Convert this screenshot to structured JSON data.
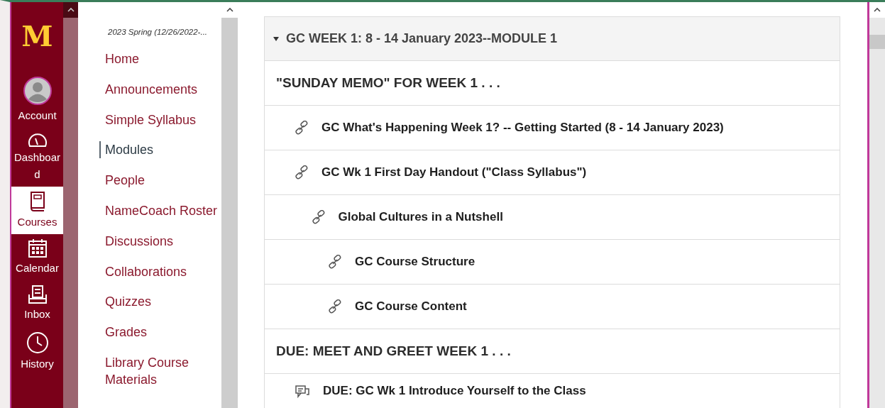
{
  "logo": "M",
  "global_nav": [
    {
      "label": "Account",
      "kind": "account",
      "selected": false
    },
    {
      "label": "Dashboard",
      "kind": "dashboard",
      "selected": false
    },
    {
      "label": "Courses",
      "kind": "courses",
      "selected": true
    },
    {
      "label": "Calendar",
      "kind": "calendar",
      "selected": false
    },
    {
      "label": "Inbox",
      "kind": "inbox",
      "selected": false
    },
    {
      "label": "History",
      "kind": "history",
      "selected": false
    }
  ],
  "course_nav": {
    "term": "2023 Spring (12/26/2022-...",
    "items": [
      {
        "label": "Home",
        "selected": false
      },
      {
        "label": "Announcements",
        "selected": false
      },
      {
        "label": "Simple Syllabus",
        "selected": false
      },
      {
        "label": "Modules",
        "selected": true
      },
      {
        "label": "People",
        "selected": false
      },
      {
        "label": "NameCoach Roster",
        "selected": false
      },
      {
        "label": "Discussions",
        "selected": false
      },
      {
        "label": "Collaborations",
        "selected": false
      },
      {
        "label": "Quizzes",
        "selected": false
      },
      {
        "label": "Grades",
        "selected": false
      },
      {
        "label": "Library Course Materials",
        "selected": false
      }
    ]
  },
  "module": {
    "title": "GC WEEK 1: 8 - 14 January 2023--MODULE 1",
    "expanded": true,
    "items": [
      {
        "kind": "header",
        "title": "\"SUNDAY MEMO\" FOR WEEK 1 . . ."
      },
      {
        "kind": "link",
        "title": "GC What's Happening Week 1? -- Getting Started (8 - 14 January 2023)"
      },
      {
        "kind": "link",
        "title": "GC Wk 1 First Day Handout (\"Class Syllabus\")",
        "children": [
          {
            "kind": "link",
            "title": "Global Cultures in a Nutshell",
            "children": [
              {
                "kind": "link",
                "title": "GC Course Structure"
              },
              {
                "kind": "link",
                "title": "GC Course Content"
              }
            ]
          }
        ]
      },
      {
        "kind": "header",
        "title": "DUE: MEET AND GREET WEEK 1 . . ."
      },
      {
        "kind": "discussion",
        "title": "DUE: GC Wk 1 Introduce Yourself to the Class"
      }
    ]
  }
}
